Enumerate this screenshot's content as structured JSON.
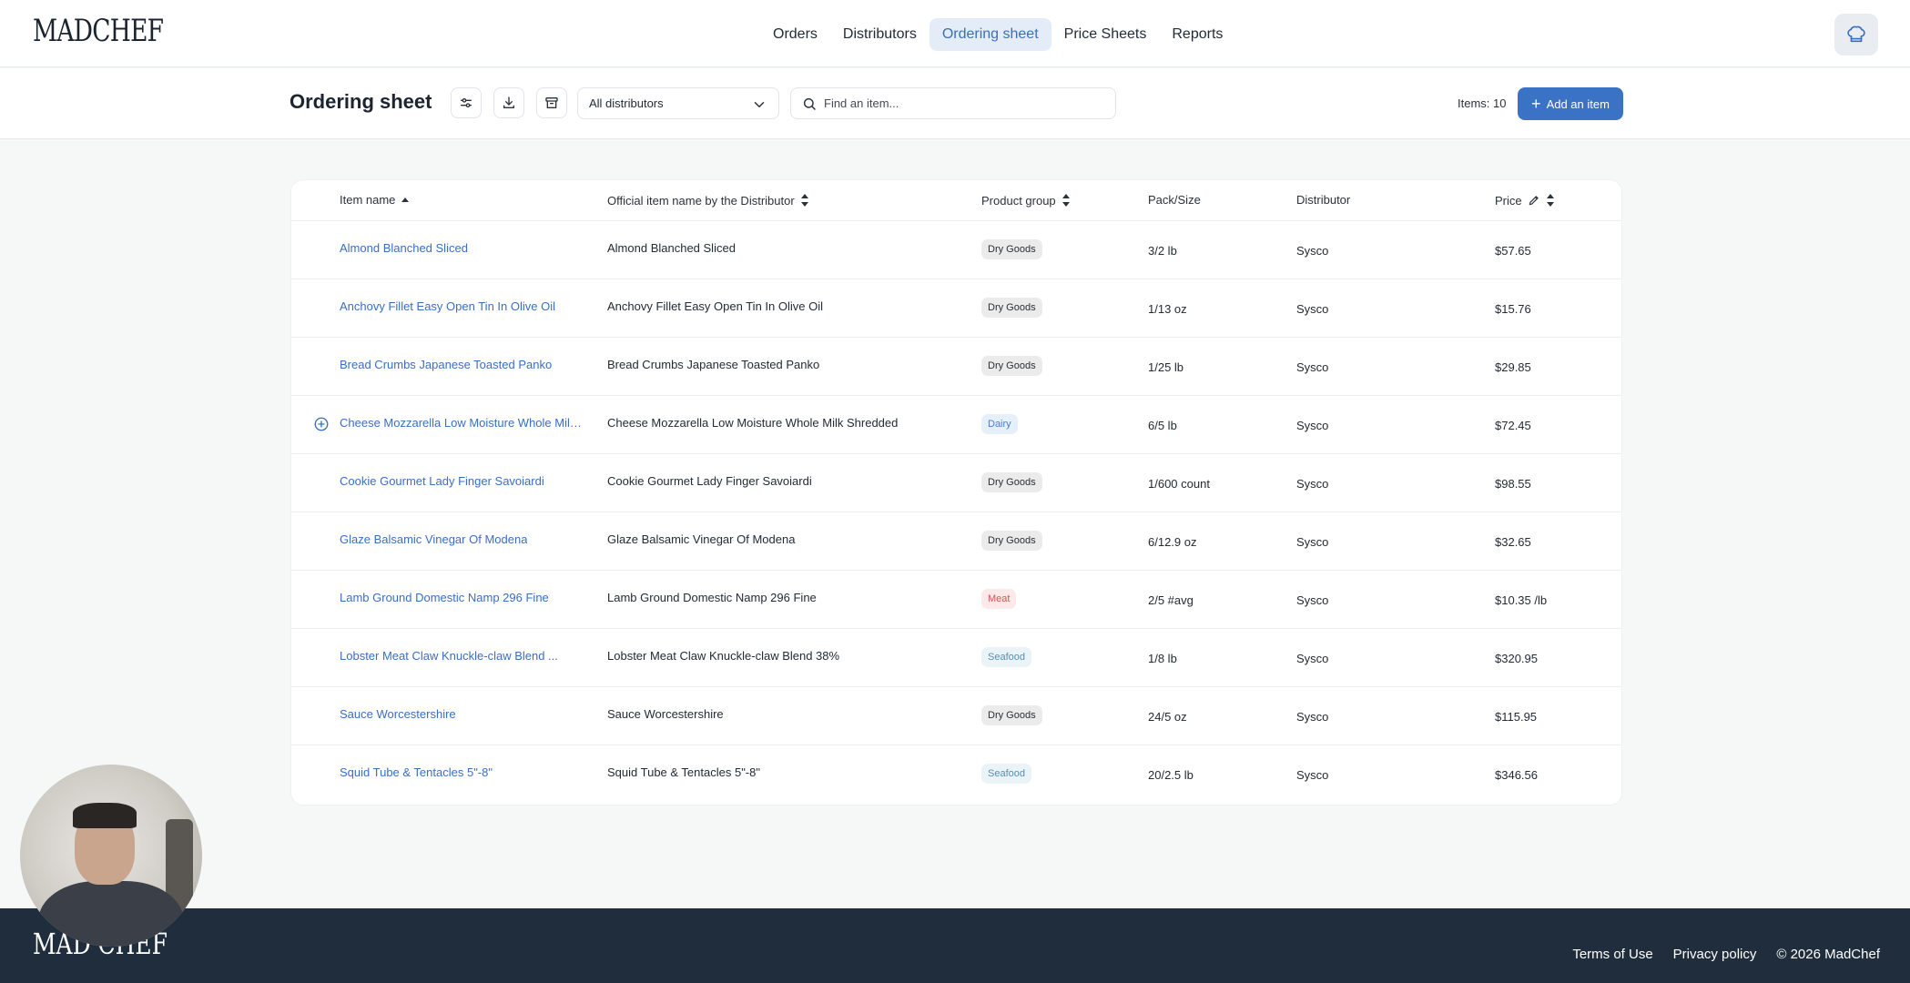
{
  "brand": {
    "logo_text": "MADCHEF",
    "footer_logo_text": "MAD CHEF"
  },
  "nav": {
    "items": [
      {
        "label": "Orders",
        "active": false
      },
      {
        "label": "Distributors",
        "active": false
      },
      {
        "label": "Ordering sheet",
        "active": true
      },
      {
        "label": "Price Sheets",
        "active": false
      },
      {
        "label": "Reports",
        "active": false
      }
    ],
    "profile_icon": "chef-hat-icon"
  },
  "toolbar": {
    "title": "Ordering sheet",
    "icons": [
      "sliders-icon",
      "download-icon",
      "archive-icon"
    ],
    "distributor_select": "All distributors",
    "search_placeholder": "Find an item...",
    "items_count": "Items: 10",
    "add_button": "Add an item"
  },
  "table": {
    "headers": {
      "item_name": "Item name",
      "official": "Official item name by the Distributor",
      "group": "Product group",
      "pack": "Pack/Size",
      "distributor": "Distributor",
      "price": "Price"
    },
    "rows": [
      {
        "name": "Almond Blanched Sliced",
        "official": "Almond Blanched Sliced",
        "group": "Dry Goods",
        "pack": "3/2 lb",
        "distributor": "Sysco",
        "price": "$57.65"
      },
      {
        "name": "Anchovy Fillet Easy Open Tin In Olive Oil",
        "official": "Anchovy Fillet Easy Open Tin In Olive Oil",
        "group": "Dry Goods",
        "pack": "1/13 oz",
        "distributor": "Sysco",
        "price": "$15.76"
      },
      {
        "name": "Bread Crumbs Japanese Toasted Panko",
        "official": "Bread Crumbs Japanese Toasted Panko",
        "group": "Dry Goods",
        "pack": "1/25 lb",
        "distributor": "Sysco",
        "price": "$29.85"
      },
      {
        "name": "Cheese Mozzarella Low Moisture Whole Milk...",
        "official": "Cheese Mozzarella Low Moisture Whole Milk Shredded",
        "group": "Dairy",
        "pack": "6/5 lb",
        "distributor": "Sysco",
        "price": "$72.45"
      },
      {
        "name": "Cookie Gourmet Lady Finger Savoiardi",
        "official": "Cookie Gourmet Lady Finger Savoiardi",
        "group": "Dry Goods",
        "pack": "1/600 count",
        "distributor": "Sysco",
        "price": "$98.55"
      },
      {
        "name": "Glaze Balsamic Vinegar Of Modena",
        "official": "Glaze Balsamic Vinegar Of Modena",
        "group": "Dry Goods",
        "pack": "6/12.9 oz",
        "distributor": "Sysco",
        "price": "$32.65"
      },
      {
        "name": "Lamb Ground Domestic Namp 296 Fine",
        "official": "Lamb Ground Domestic Namp 296 Fine",
        "group": "Meat",
        "pack": "2/5 #avg",
        "distributor": "Sysco",
        "price": "$10.35 /lb"
      },
      {
        "name": "Lobster Meat Claw Knuckle-claw Blend ...",
        "official": "Lobster Meat Claw Knuckle-claw Blend 38%",
        "group": "Seafood",
        "pack": "1/8 lb",
        "distributor": "Sysco",
        "price": "$320.95"
      },
      {
        "name": "Sauce Worcestershire",
        "official": "Sauce Worcestershire",
        "group": "Dry Goods",
        "pack": "24/5 oz",
        "distributor": "Sysco",
        "price": "$115.95"
      },
      {
        "name": "Squid Tube & Tentacles 5\"-8\"",
        "official": "Squid Tube & Tentacles 5\"-8\"",
        "group": "Seafood",
        "pack": "20/2.5 lb",
        "distributor": "Sysco",
        "price": "$346.56"
      }
    ]
  },
  "badge_colors": {
    "Dry Goods": {
      "bg": "#ebebeb",
      "fg": "#2a2f36"
    },
    "Dairy": {
      "bg": "#e6f0fb",
      "fg": "#4a7fc4"
    },
    "Meat": {
      "bg": "#fde9e9",
      "fg": "#d9534f"
    },
    "Seafood": {
      "bg": "#eaf4f8",
      "fg": "#5a8fa8"
    }
  },
  "footer": {
    "links": [
      "Terms of Use",
      "Privacy policy",
      "© 2026 MadChef"
    ]
  },
  "colors": {
    "accent": "#3a72c6",
    "link": "#3a6fbf",
    "footer_bg": "#1f2d3d"
  }
}
